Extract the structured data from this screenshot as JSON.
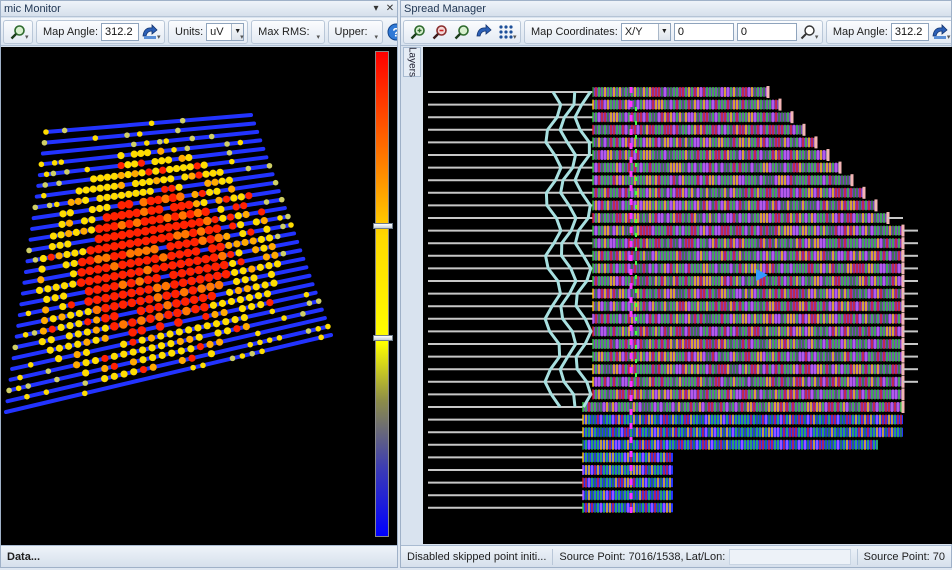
{
  "left": {
    "title": "mic Monitor",
    "toolbar": {
      "map_angle_label": "Map Angle:",
      "map_angle_value": "312.2",
      "units_label": "Units:",
      "units_value": "uV",
      "max_rms_label": "Max RMS:",
      "upper_label": "Upper:"
    },
    "status_text": "Data...",
    "colorbar": {
      "upper_handle": 0.36,
      "lower_handle": 0.59
    }
  },
  "right": {
    "title": "Spread Manager",
    "layers_tab": "Layers",
    "toolbar": {
      "map_coords_label": "Map Coordinates:",
      "map_coords_value": "X/Y",
      "coord_x": "0",
      "coord_y": "0",
      "map_angle_label": "Map Angle:",
      "map_angle_value": "312.2"
    },
    "status": {
      "message": "Disabled skipped point initi...",
      "source_point": "Source Point: 7016/1538,",
      "latlon_label": "Lat/Lon:",
      "source_point_right": "Source Point: 70"
    }
  },
  "colors": {
    "map_bg": "#000000",
    "receiver_line": "#2233ff",
    "hot": "#ff2200",
    "warm": "#ffdd00",
    "spread_lines": "#c8c8c8",
    "spread_outline": "#f3b5b5",
    "cyan_trace": "#a8e0e0",
    "magenta": "#ff33ff"
  },
  "icons": {
    "zoom": "magnifier-icon",
    "angle": "rotate-map-icon",
    "help": "help-icon"
  }
}
